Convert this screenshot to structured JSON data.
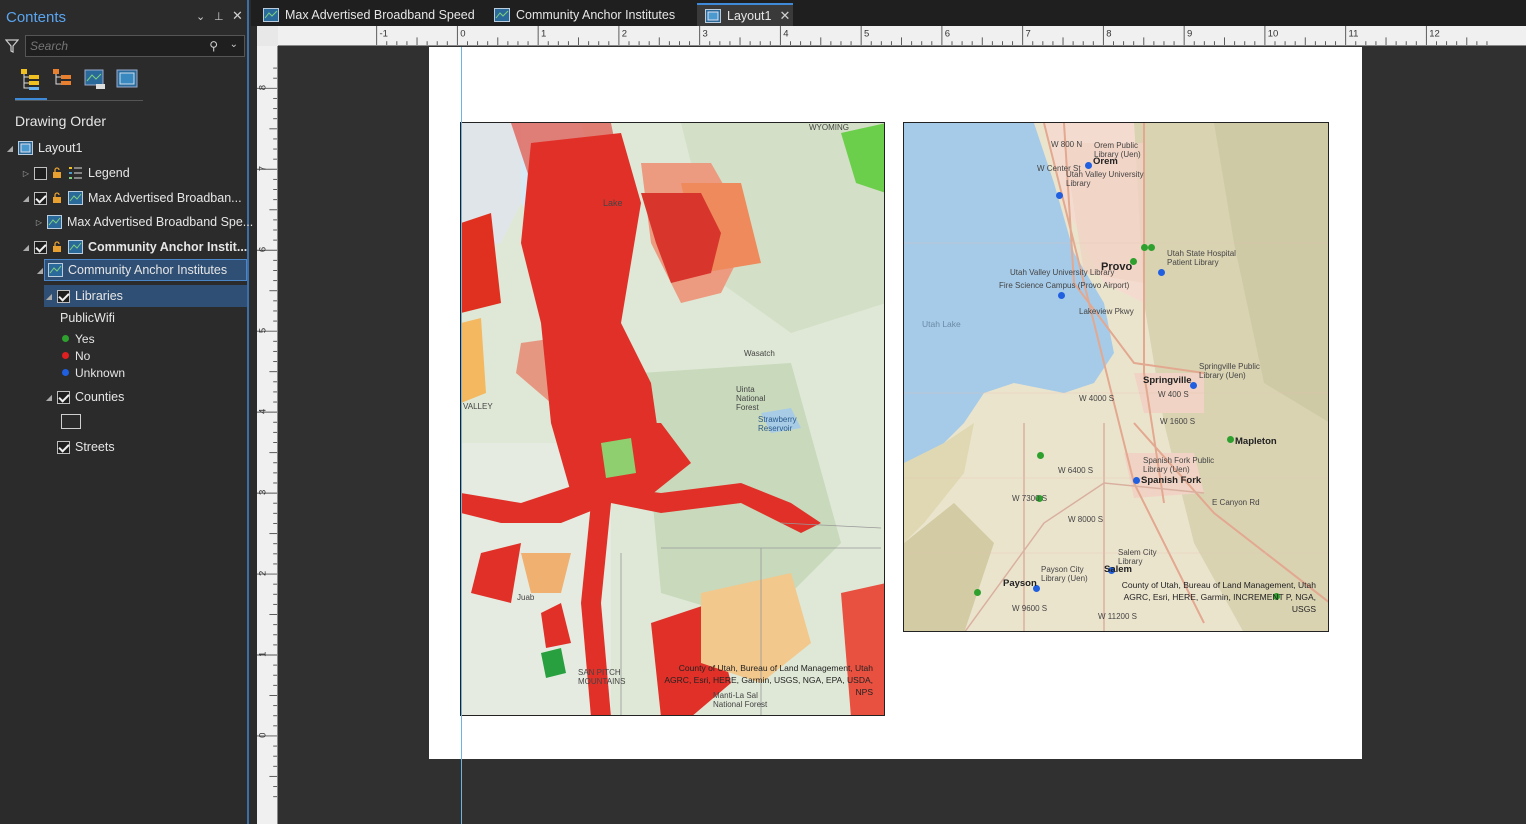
{
  "contents": {
    "title": "Contents",
    "search_placeholder": "Search",
    "section": "Drawing Order",
    "tree": {
      "layout": "Layout1",
      "legend": "Legend",
      "map1": "Max Advertised Broadban...",
      "map1_layer": "Max Advertised Broadband Spe...",
      "map2": "Community Anchor Instit...",
      "map2_group": "Community Anchor Institutes",
      "libraries": "Libraries",
      "field": "PublicWifi",
      "yes": "Yes",
      "no": "No",
      "unknown": "Unknown",
      "counties": "Counties",
      "streets": "Streets"
    },
    "legend_colors": {
      "yes": "#2ea02e",
      "no": "#e02020",
      "unknown": "#1f5fe0"
    }
  },
  "tabs": [
    {
      "label": "Max Advertised Broadband Speed"
    },
    {
      "label": "Community Anchor Institutes"
    },
    {
      "label": "Layout1"
    }
  ],
  "ruler": {
    "h": [
      "-1",
      "0",
      "1",
      "2",
      "3",
      "4",
      "5",
      "6",
      "7",
      "8",
      "9",
      "10",
      "11",
      "12"
    ],
    "v": [
      "8",
      "7",
      "6",
      "5",
      "4",
      "3",
      "2",
      "1",
      "0"
    ]
  },
  "map_left": {
    "credit": "County of Utah, Bureau of Land Management, Utah AGRC, Esri, HERE, Garmin, USGS, NGA, EPA, USDA, NPS",
    "labels": [
      "WYOMING",
      "Lake",
      "Wasatch",
      "Uinta National Forest",
      "Strawberry Reservoir",
      "VALLEY",
      "SAN PITCH MOUNTAINS",
      "Manti-La Sal National Forest",
      "Juab"
    ]
  },
  "map_right": {
    "credit": "County of Utah, Bureau of Land Management, Utah AGRC, Esri, HERE, Garmin, INCREMENT P, NGA, USGS",
    "cities": [
      "Orem",
      "Provo",
      "Springville",
      "Mapleton",
      "Spanish Fork",
      "Payson",
      "Salem",
      "Utah Lake"
    ],
    "libraries": [
      "Orem Public Library (Uen)",
      "Utah Valley University Library",
      "Utah State Hospital Patient Library",
      "Utah Valley University Library",
      "Fire Science Campus (Provo Airport)",
      "Springville Public Library (Uen)",
      "Spanish Fork Public Library (Uen)",
      "Salem City Library",
      "Payson City Library (Uen)"
    ],
    "roads": [
      "W 800 N",
      "W Center St",
      "W 400 S",
      "W 4000 S",
      "W 1600 S",
      "W 6400 S",
      "W 7300 S",
      "W 8000 S",
      "W 9600 S",
      "W 11200 S",
      "E Canyon Rd",
      "Lakeview Pkwy"
    ]
  }
}
